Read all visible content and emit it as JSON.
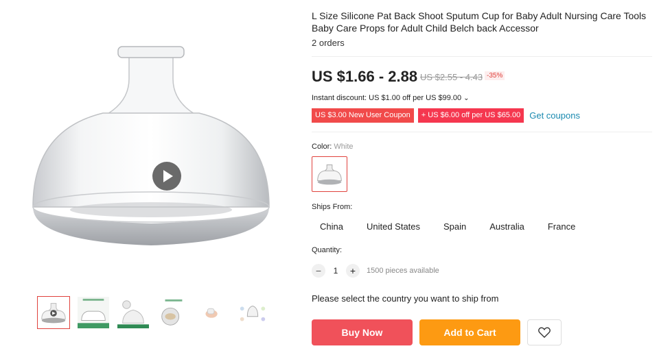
{
  "product": {
    "title": "L Size Silicone Pat Back Shoot Sputum Cup for Baby Adult Nursing Care Tools Baby Care Props for Adult Child Belch back Accessor",
    "orders": "2 orders",
    "price": "US $1.66 - 2.88",
    "original_price": "US $2.55 - 4.43",
    "discount_badge": "-35%"
  },
  "promotions": {
    "instant_discount": "Instant discount: US $1.00 off per US $99.00",
    "coupons": [
      "US $3.00 New User Coupon",
      "+ US $6.00 off per US $65.00"
    ],
    "get_coupons": "Get coupons"
  },
  "options": {
    "color_label": "Color:",
    "color_value": "White",
    "ships_from_label": "Ships From:",
    "countries": [
      "China",
      "United States",
      "Spain",
      "Australia",
      "France"
    ]
  },
  "quantity": {
    "label": "Quantity:",
    "minus": "−",
    "value": "1",
    "plus": "+",
    "available": "1500 pieces available"
  },
  "ship_note": "Please select the country you want to ship from",
  "actions": {
    "buy_now": "Buy Now",
    "add_to_cart": "Add to Cart"
  },
  "gallery": {
    "thumbnail_count": 6,
    "active_index": 0
  },
  "colors": {
    "accent_red": "#e0413c",
    "buy_now": "#f0515a",
    "add_to_cart": "#fd9a12",
    "link": "#1a8ab0"
  }
}
